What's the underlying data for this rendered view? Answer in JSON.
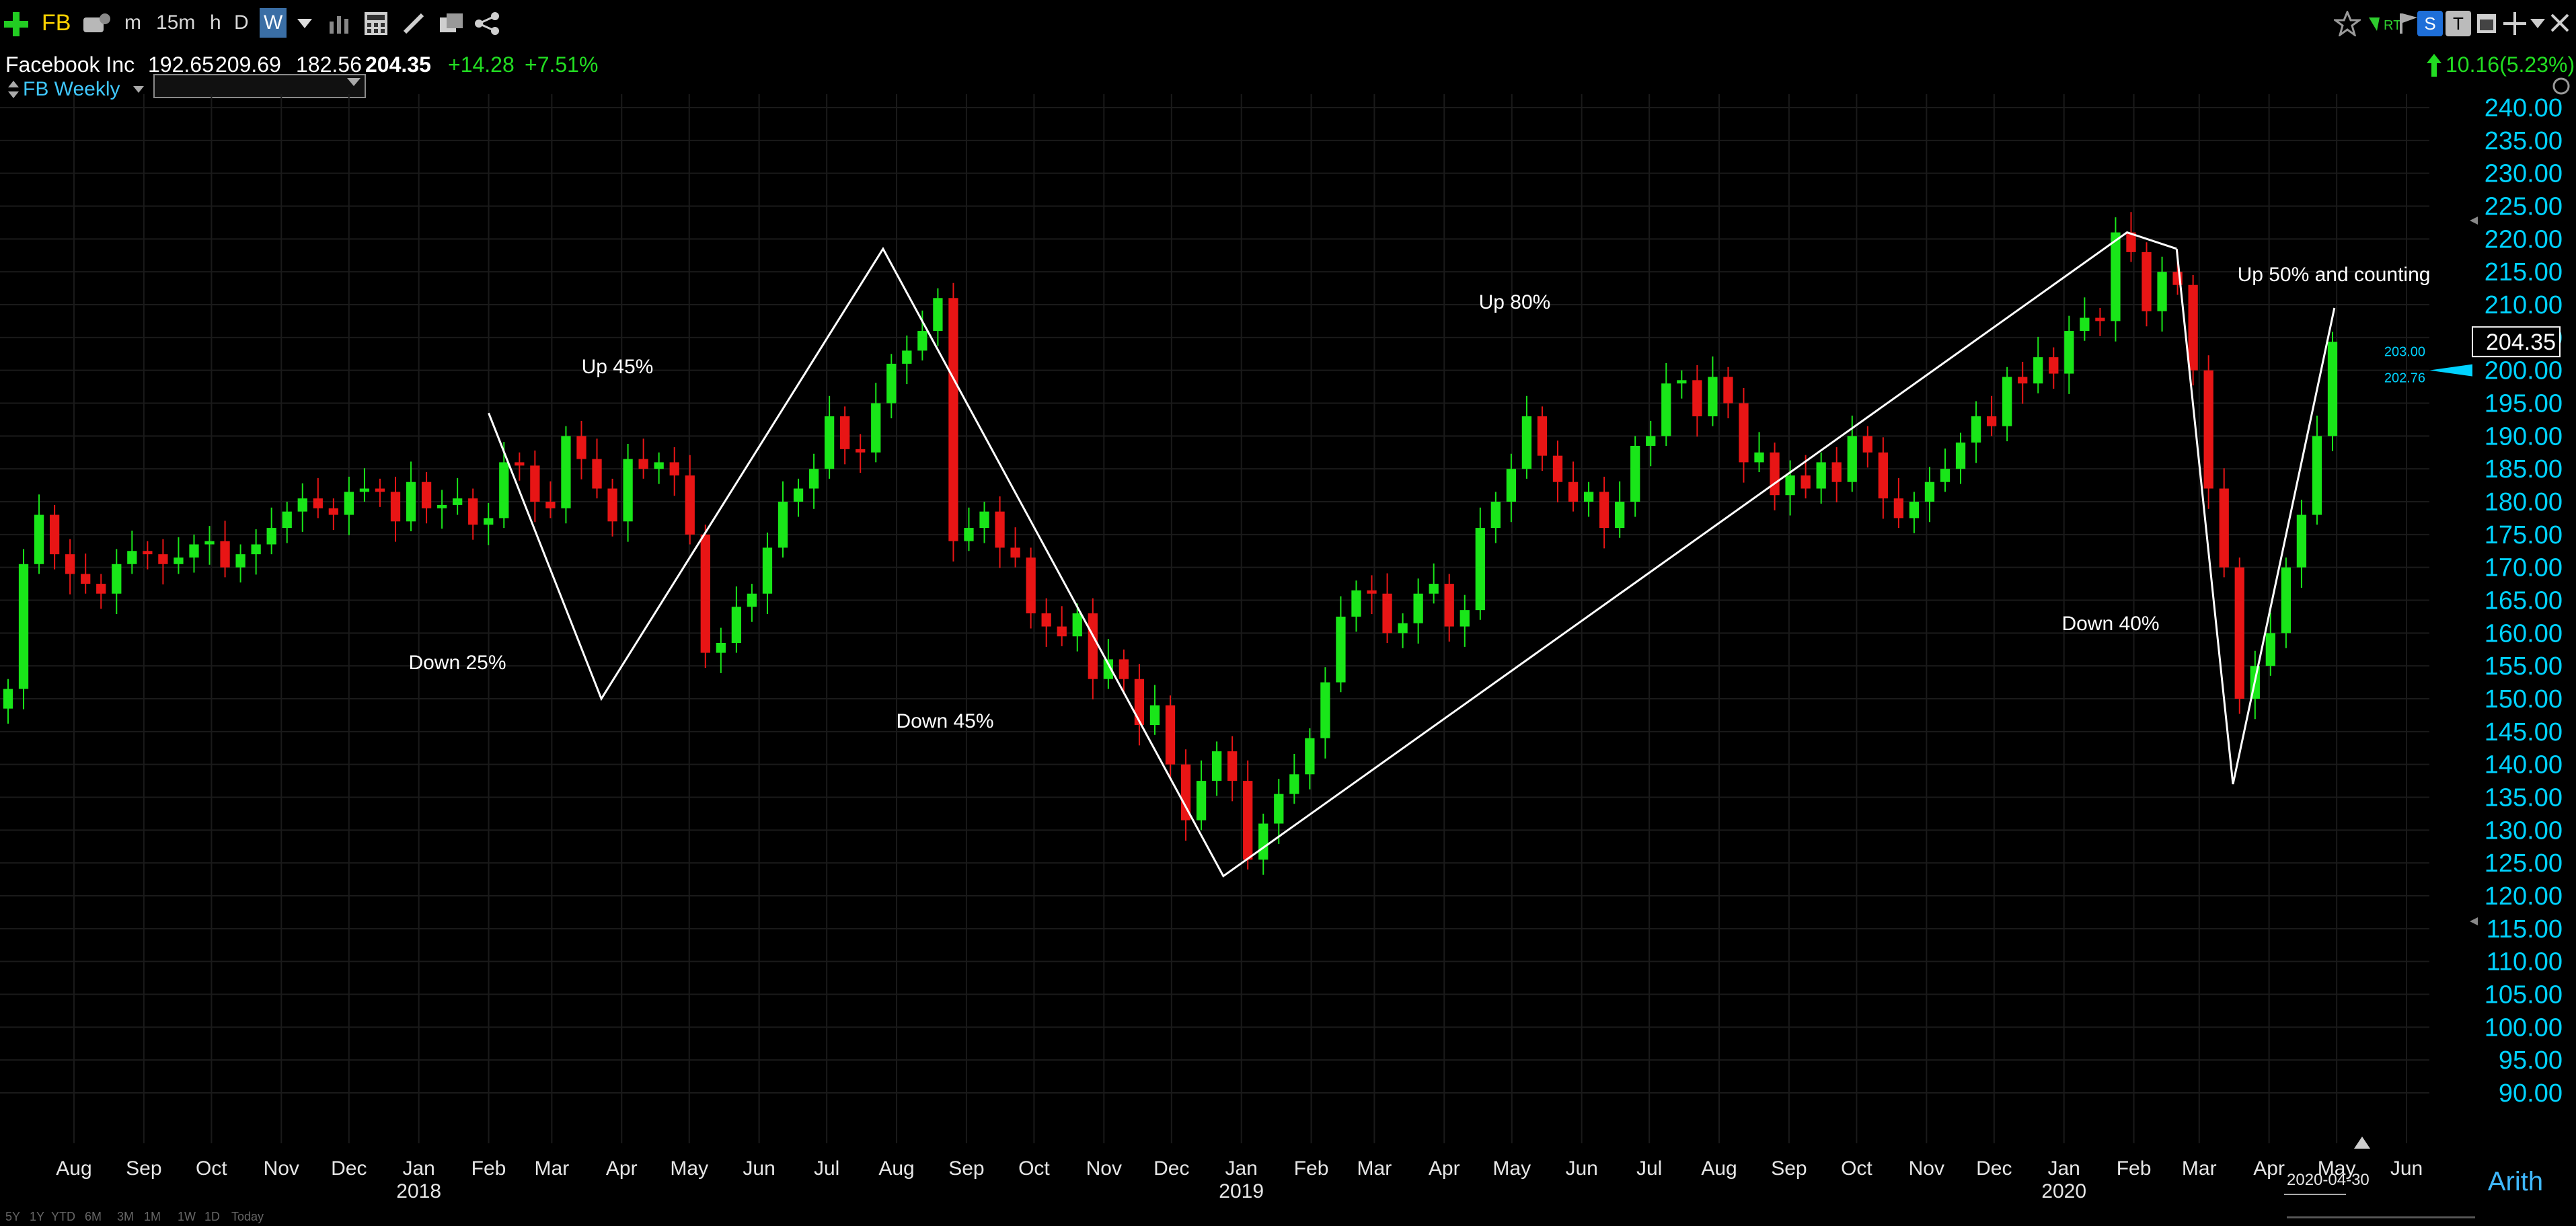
{
  "toolbar": {
    "symbol": "FB",
    "intervals": [
      "m",
      "15m",
      "h",
      "D",
      "W"
    ],
    "active_interval": "W",
    "right_rt": "RT",
    "right_s": "S",
    "right_t": "T"
  },
  "quote": {
    "name": "Facebook Inc",
    "open": "192.65",
    "high": "209.69",
    "low": "182.56",
    "last": "204.35",
    "change": "+14.28",
    "change_pct": "+7.51%",
    "right_change": "10.16(5.23%)"
  },
  "chart_selector": {
    "label": "FB Weekly"
  },
  "footer": {
    "ranges": [
      "5Y",
      "1Y",
      "YTD",
      "6M",
      "3M",
      "1M",
      "1W",
      "1D",
      "Today"
    ],
    "date_box": "2020-04-30",
    "scale": "Arith"
  },
  "colors": {
    "up": "#19e619",
    "down": "#e81515",
    "accent": "#00d2ff",
    "grid": "#1a1a1a"
  },
  "chart_data": {
    "type": "candlestick",
    "title": "FB Weekly",
    "ylim": [
      90,
      240
    ],
    "y_ticks": [
      "240.00",
      "235.00",
      "230.00",
      "225.00",
      "220.00",
      "215.00",
      "210.00",
      "205.00",
      "200.00",
      "195.00",
      "190.00",
      "185.00",
      "180.00",
      "175.00",
      "170.00",
      "165.00",
      "160.00",
      "155.00",
      "150.00",
      "145.00",
      "140.00",
      "135.00",
      "130.00",
      "125.00",
      "120.00",
      "115.00",
      "110.00",
      "105.00",
      "100.00",
      "95.00",
      "90.00"
    ],
    "x_tick_labels": [
      {
        "label": "Aug",
        "date": "2017-08-01"
      },
      {
        "label": "Sep",
        "date": "2017-09-01"
      },
      {
        "label": "Oct",
        "date": "2017-10-01"
      },
      {
        "label": "Nov",
        "date": "2017-11-01"
      },
      {
        "label": "Dec",
        "date": "2017-12-01"
      },
      {
        "label": "Jan",
        "date": "2018-01-01"
      },
      {
        "label": "Feb",
        "date": "2018-02-01"
      },
      {
        "label": "Mar",
        "date": "2018-03-01"
      },
      {
        "label": "Apr",
        "date": "2018-04-01"
      },
      {
        "label": "May",
        "date": "2018-05-01"
      },
      {
        "label": "Jun",
        "date": "2018-06-01"
      },
      {
        "label": "Jul",
        "date": "2018-07-01"
      },
      {
        "label": "Aug",
        "date": "2018-08-01"
      },
      {
        "label": "Sep",
        "date": "2018-09-01"
      },
      {
        "label": "Oct",
        "date": "2018-10-01"
      },
      {
        "label": "Nov",
        "date": "2018-11-01"
      },
      {
        "label": "Dec",
        "date": "2018-12-01"
      },
      {
        "label": "Jan",
        "date": "2019-01-01"
      },
      {
        "label": "Feb",
        "date": "2019-02-01"
      },
      {
        "label": "Mar",
        "date": "2019-03-01"
      },
      {
        "label": "Apr",
        "date": "2019-04-01"
      },
      {
        "label": "May",
        "date": "2019-05-01"
      },
      {
        "label": "Jun",
        "date": "2019-06-01"
      },
      {
        "label": "Jul",
        "date": "2019-07-01"
      },
      {
        "label": "Aug",
        "date": "2019-08-01"
      },
      {
        "label": "Sep",
        "date": "2019-09-01"
      },
      {
        "label": "Oct",
        "date": "2019-10-01"
      },
      {
        "label": "Nov",
        "date": "2019-11-01"
      },
      {
        "label": "Dec",
        "date": "2019-12-01"
      },
      {
        "label": "Jan",
        "date": "2020-01-01"
      },
      {
        "label": "Feb",
        "date": "2020-02-01"
      },
      {
        "label": "Mar",
        "date": "2020-03-01"
      },
      {
        "label": "Apr",
        "date": "2020-04-01"
      },
      {
        "label": "May",
        "date": "2020-05-01"
      },
      {
        "label": "Jun",
        "date": "2020-06-01"
      }
    ],
    "x_year_labels": [
      {
        "label": "2018",
        "date": "2018-01-01"
      },
      {
        "label": "2019",
        "date": "2019-01-01"
      },
      {
        "label": "2020",
        "date": "2020-01-01"
      }
    ],
    "price_markers": [
      "203.00",
      "202.76",
      "204.35"
    ],
    "closes": [
      151.5,
      170.5,
      178.0,
      172.0,
      169.0,
      167.5,
      166.0,
      170.5,
      172.5,
      172.0,
      170.5,
      171.5,
      173.5,
      174.0,
      170.0,
      172.0,
      173.5,
      176.0,
      178.5,
      180.5,
      179.0,
      178.0,
      181.5,
      182.0,
      181.5,
      177.0,
      183.0,
      179.0,
      179.5,
      180.5,
      176.5,
      177.5,
      186.0,
      185.5,
      180.0,
      179.0,
      190.0,
      186.5,
      182.0,
      177.0,
      186.5,
      185.0,
      186.0,
      184.0,
      175.0,
      157.0,
      158.5,
      164.0,
      166.0,
      173.0,
      180.0,
      182.0,
      185.0,
      193.0,
      188.0,
      187.5,
      195.0,
      201.0,
      203.0,
      206.0,
      211.0,
      174.0,
      176.0,
      178.5,
      173.0,
      171.5,
      163.0,
      161.0,
      159.5,
      163.0,
      153.0,
      156.0,
      153.0,
      146.0,
      149.0,
      140.0,
      131.5,
      137.5,
      142.0,
      137.5,
      125.5,
      131.0,
      135.5,
      138.5,
      144.0,
      152.5,
      162.5,
      166.5,
      166.0,
      160.0,
      161.5,
      166.0,
      167.5,
      161.0,
      163.5,
      176.0,
      180.0,
      185.0,
      193.0,
      187.0,
      183.0,
      180.0,
      181.5,
      176.0,
      180.0,
      188.5,
      190.0,
      198.0,
      198.5,
      193.0,
      199.0,
      195.0,
      186.0,
      187.5,
      181.0,
      184.0,
      182.0,
      186.0,
      183.0,
      190.0,
      187.5,
      180.5,
      177.5,
      180.0,
      183.0,
      185.0,
      189.0,
      193.0,
      191.5,
      199.0,
      198.0,
      202.0,
      199.5,
      206.0,
      208.0,
      207.5,
      221.0,
      218.0,
      209.0,
      215.0,
      213.0,
      200.0,
      182.0,
      170.0,
      150.0,
      155.0,
      160.0,
      170.0,
      178.0,
      190.0,
      204.35
    ],
    "annotations": [
      {
        "text": "Down 25%"
      },
      {
        "text": "Up 45%"
      },
      {
        "text": "Down 45%"
      },
      {
        "text": "Up 80%"
      },
      {
        "text": "Down 40%"
      },
      {
        "text": "Up 50% and counting"
      }
    ],
    "trendline_pivots": [
      {
        "date": "2018-02-01",
        "price": 193.5
      },
      {
        "date": "2018-03-23",
        "price": 150.0
      },
      {
        "date": "2018-07-26",
        "price": 218.5
      },
      {
        "date": "2018-12-24",
        "price": 123.0
      },
      {
        "date": "2020-01-29",
        "price": 221.0
      },
      {
        "date": "2020-02-20",
        "price": 218.5
      },
      {
        "date": "2020-03-16",
        "price": 137.0
      },
      {
        "date": "2020-04-30",
        "price": 209.5
      }
    ]
  }
}
